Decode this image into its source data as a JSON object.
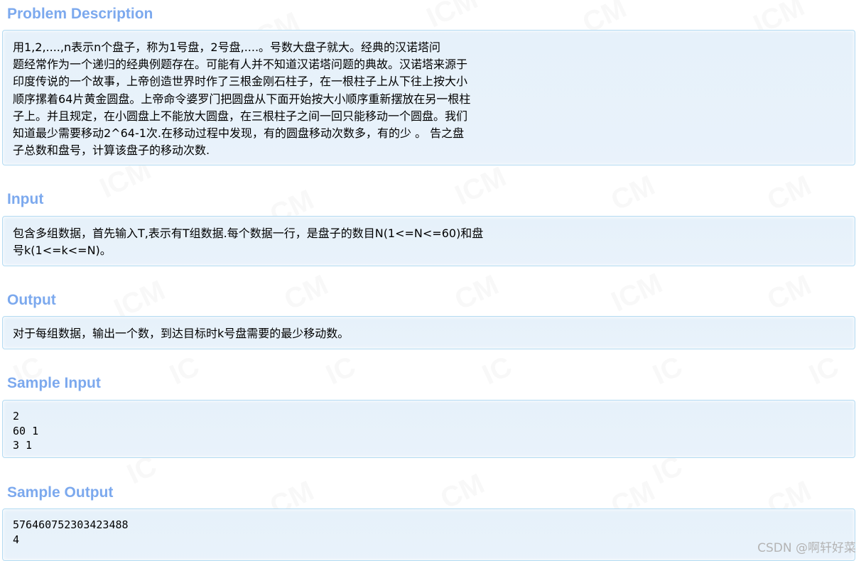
{
  "sections": {
    "problem_description": {
      "title": "Problem Description",
      "text": "用1,2,....,n表示n个盘子，称为1号盘，2号盘,....。号数大盘子就大。经典的汉诺塔问\n题经常作为一个递归的经典例题存在。可能有人并不知道汉诺塔问题的典故。汉诺塔来源于\n印度传说的一个故事，上帝创造世界时作了三根金刚石柱子，在一根柱子上从下往上按大小\n顺序摞着64片黄金圆盘。上帝命令婆罗门把圆盘从下面开始按大小顺序重新摆放在另一根柱\n子上。并且规定，在小圆盘上不能放大圆盘，在三根柱子之间一回只能移动一个圆盘。我们\n知道最少需要移动2^64-1次.在移动过程中发现，有的圆盘移动次数多，有的少 。 告之盘\n子总数和盘号，计算该盘子的移动次数."
    },
    "input": {
      "title": "Input",
      "text": "包含多组数据，首先输入T,表示有T组数据.每个数据一行，是盘子的数目N(1<=N<=60)和盘\n号k(1<=k<=N)。"
    },
    "output": {
      "title": "Output",
      "text": "对于每组数据，输出一个数，到达目标时k号盘需要的最少移动数。"
    },
    "sample_input": {
      "title": "Sample Input",
      "text": "2\n60 1\n3 1"
    },
    "sample_output": {
      "title": "Sample Output",
      "text": "576460752303423488\n4"
    }
  },
  "watermark": {
    "credit": "CSDN @啊轩好菜"
  },
  "colors": {
    "title": "#7ca9ee",
    "panel_border": "#b4dbf2",
    "panel_background": "#e6f1fa",
    "watermark_text": "#b4b4b4"
  }
}
